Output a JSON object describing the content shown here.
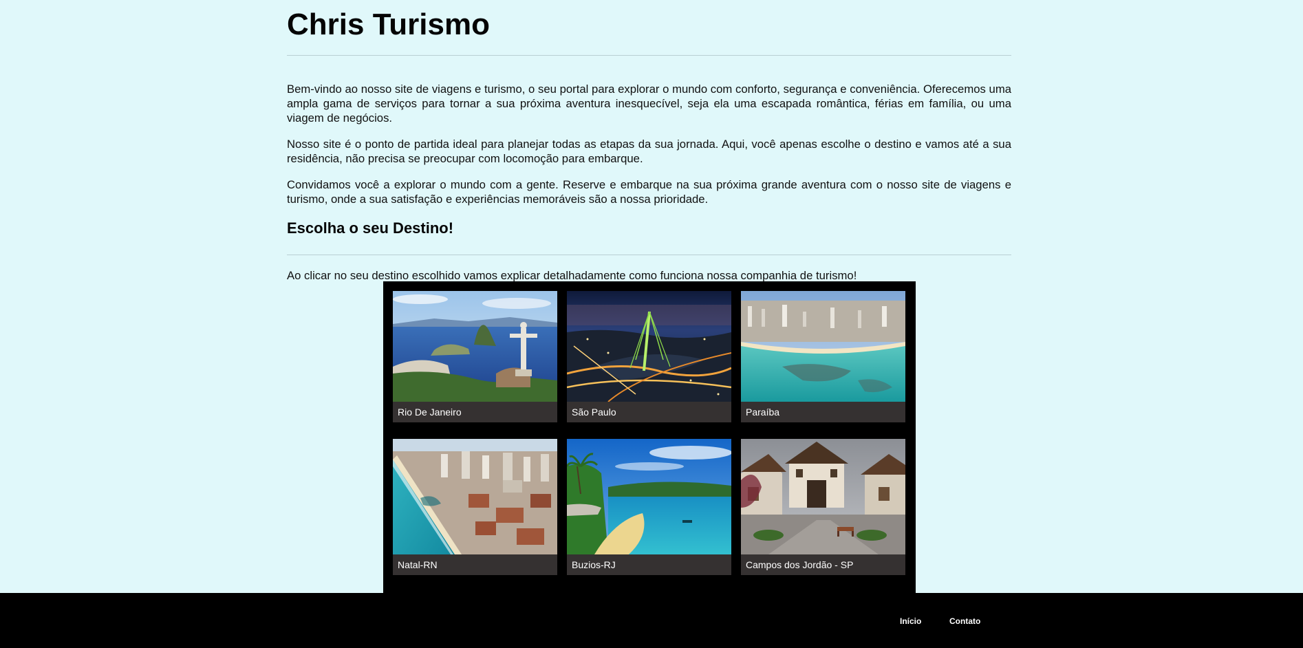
{
  "header": {
    "title": "Chris Turismo"
  },
  "intro": {
    "paragraphs": [
      "Bem-vindo ao nosso site de viagens e turismo, o seu portal para explorar o mundo com conforto, segurança e conveniência. Oferecemos uma ampla gama de serviços para tornar a sua próxima aventura inesquecível, seja ela uma escapada romântica, férias em família, ou uma viagem de negócios.",
      "Nosso site é o ponto de partida ideal para planejar todas as etapas da sua jornada. Aqui, você apenas escolhe o destino e vamos até a sua residência, não precisa se preocupar com locomoção para embarque.",
      "Convidamos você a explorar o mundo com a gente. Reserve e embarque na sua próxima grande aventura com o nosso site de viagens e turismo, onde a sua satisfação e experiências memoráveis são a nossa prioridade."
    ]
  },
  "destinations": {
    "title": "Escolha o seu Destino!",
    "subtitle": "Ao clicar no seu destino escolhido vamos explicar detalhadamente como funciona nossa companhia de turismo!",
    "items": [
      {
        "label": "Rio De Janeiro"
      },
      {
        "label": "São Paulo"
      },
      {
        "label": "Paraíba"
      },
      {
        "label": "Natal-RN"
      },
      {
        "label": "Buzios-RJ"
      },
      {
        "label": "Campos dos Jordão - SP"
      }
    ]
  },
  "footer": {
    "links": [
      {
        "label": "Início"
      },
      {
        "label": "Contato"
      }
    ]
  },
  "colors": {
    "page_background": "#e0f8fa",
    "gallery_background": "#000000",
    "caption_background": "#353131",
    "footer_background": "#000000"
  }
}
